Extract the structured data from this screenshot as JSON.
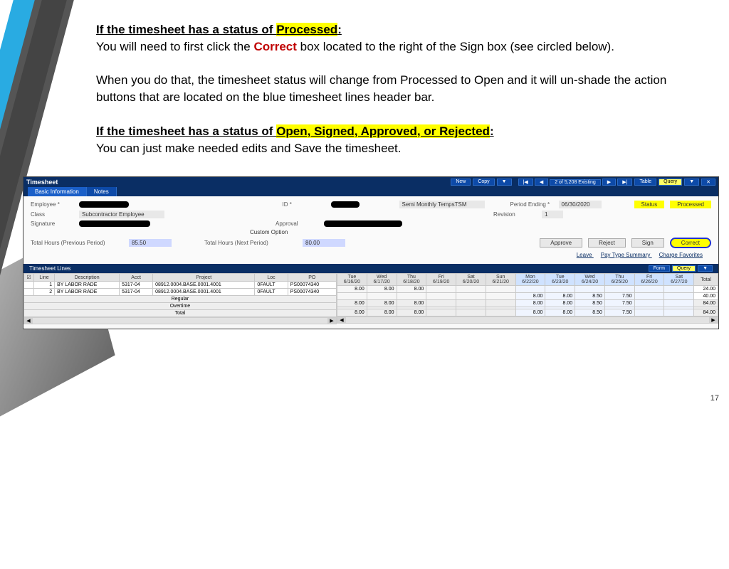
{
  "slide": {
    "heading1_prefix": "If the timesheet has a status of ",
    "heading1_status": "Processed",
    "heading1_colon": ":",
    "p1_a": "You will need to first click the ",
    "p1_correct": "Correct",
    "p1_b": " box located to the right of the Sign box (see circled below).",
    "p2": "When you do that, the timesheet status will change from Processed to Open and it will un-shade the action buttons that are located on the blue timesheet lines header bar.",
    "heading2_prefix": "If the timesheet has a status of ",
    "heading2_status": "Open, Signed, Approved, or Rejected",
    "heading2_colon": ":",
    "p3": "You can just make needed edits and Save the timesheet.",
    "page_number": "17"
  },
  "timesheet": {
    "app_title": "Timesheet",
    "top_buttons": {
      "new": "New",
      "copy": "Copy",
      "nav_text": "2 of 5,208 Existing",
      "table": "Table",
      "query": "Query"
    },
    "tabs": {
      "basic": "Basic Information",
      "notes": "Notes"
    },
    "labels": {
      "employee": "Employee *",
      "id": "ID *",
      "schedule": "Semi Monthly TempsTSM",
      "period_ending": "Period Ending *",
      "period_ending_val": "06/30/2020",
      "status_lbl": "Status",
      "status_val": "Processed",
      "class": "Class",
      "class_val": "Subcontractor Employee",
      "revision": "Revision",
      "revision_val": "1",
      "signature": "Signature",
      "approval": "Approval",
      "custom_option": "Custom Option",
      "prev_hours": "Total Hours (Previous Period)",
      "prev_val": "85.50",
      "next_hours": "Total Hours (Next Period)",
      "next_val": "80.00"
    },
    "actions": {
      "approve": "Approve",
      "reject": "Reject",
      "sign": "Sign",
      "correct": "Correct"
    },
    "links": {
      "leave": "Leave",
      "pay_summary": "Pay Type Summary",
      "charge_fav": "Charge Favorites"
    },
    "lines": {
      "title": "Timesheet Lines",
      "form": "Form",
      "query": "Query",
      "cols_left": {
        "line": "Line",
        "desc": "Description",
        "acct": "Acct",
        "project": "Project",
        "loc": "Loc",
        "po": "PO"
      },
      "col_total": "Total",
      "dates_a": [
        {
          "dow": "Tue",
          "d": "6/16/20"
        },
        {
          "dow": "Wed",
          "d": "6/17/20"
        },
        {
          "dow": "Thu",
          "d": "6/18/20"
        },
        {
          "dow": "Fri",
          "d": "6/19/20"
        },
        {
          "dow": "Sat",
          "d": "6/20/20"
        },
        {
          "dow": "Sun",
          "d": "6/21/20"
        }
      ],
      "dates_b": [
        {
          "dow": "Mon",
          "d": "6/22/20"
        },
        {
          "dow": "Tue",
          "d": "6/23/20"
        },
        {
          "dow": "Wed",
          "d": "6/24/20"
        },
        {
          "dow": "Thu",
          "d": "6/25/20"
        },
        {
          "dow": "Fri",
          "d": "6/26/20"
        },
        {
          "dow": "Sat",
          "d": "6/27/20"
        }
      ],
      "rows": [
        {
          "line": "1",
          "desc": "BY LABOR RADE",
          "acct": "5317-04",
          "project": "08912.0004.BASE.0001.4001",
          "loc": "0FAULT",
          "po": "PS00074340",
          "left_vals": [
            "8.00",
            "8.00",
            "8.00",
            "",
            "",
            ""
          ],
          "right_vals": [
            "",
            "",
            "",
            "",
            "",
            ""
          ],
          "total": "24.00"
        },
        {
          "line": "2",
          "desc": "BY LABOR RADE",
          "acct": "5317-04",
          "project": "08912.0004.BASE.0001.4001",
          "loc": "0FAULT",
          "po": "PS00074340",
          "left_vals": [
            "",
            "",
            "",
            "",
            "",
            ""
          ],
          "right_vals": [
            "8.00",
            "8.00",
            "8.50",
            "7.50",
            "",
            ""
          ],
          "total": "40.00"
        }
      ],
      "summary": {
        "regular": "Regular",
        "overtime": "Overtime",
        "total": "Total",
        "reg_left": [
          "8.00",
          "8.00",
          "8.00",
          "",
          "",
          ""
        ],
        "reg_right": [
          "8.00",
          "8.00",
          "8.50",
          "7.50",
          "",
          ""
        ],
        "reg_total": "84.00",
        "tot_left": [
          "8.00",
          "8.00",
          "8.00",
          "",
          "",
          ""
        ],
        "tot_right": [
          "8.00",
          "8.00",
          "8.50",
          "7.50",
          "",
          ""
        ],
        "tot_total": "84.00"
      }
    }
  }
}
